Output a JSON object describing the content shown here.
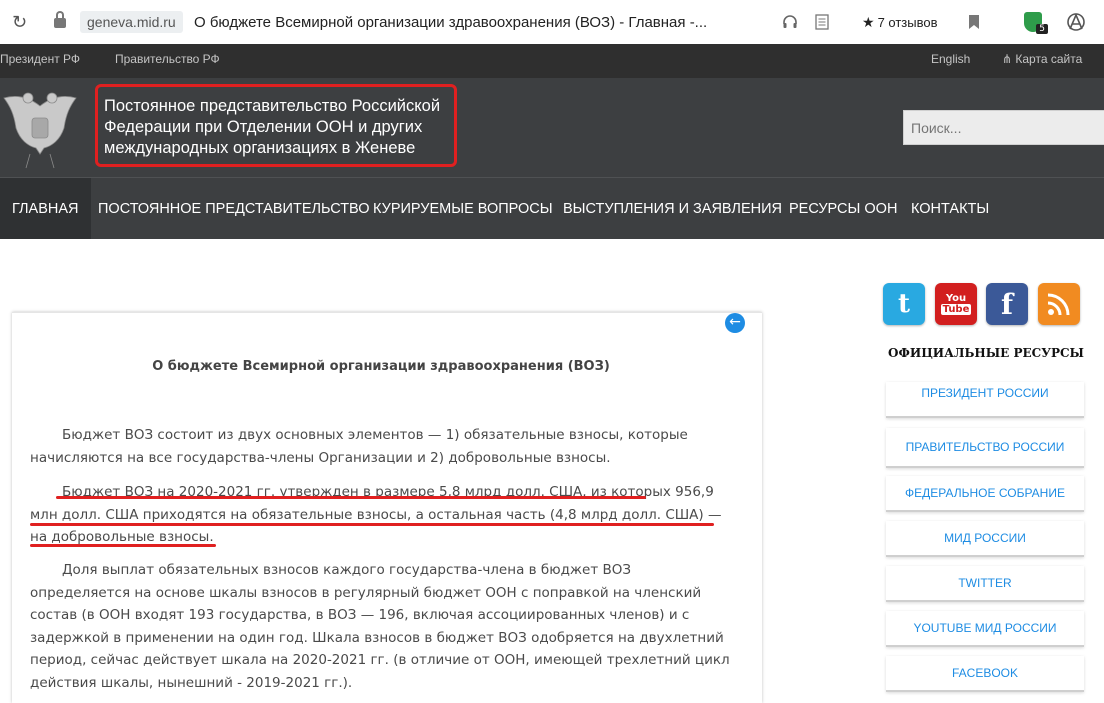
{
  "browser": {
    "domain": "geneva.mid.ru",
    "tab_title": "О бюджете Всемирной организации здравоохранения (ВОЗ) - Главная -...",
    "reviews_label": "7 отзывов",
    "shield_badge": "5"
  },
  "topbar": {
    "president_link": "Президент РФ",
    "government_link": "Правительство РФ",
    "english_link": "English",
    "sitemap_link": "Карта сайта"
  },
  "header": {
    "title_line1": "Постоянное представительство Российской",
    "title_line2": "Федерации при Отделении ООН и других",
    "title_line3": "международных организациях в Женеве",
    "search_placeholder": "Поиск..."
  },
  "nav": {
    "items": [
      {
        "label": "ГЛАВНАЯ"
      },
      {
        "label": "ПОСТОЯННОЕ ПРЕДСТАВИТЕЛЬСТВО"
      },
      {
        "label": "КУРИРУЕМЫЕ ВОПРОСЫ"
      },
      {
        "label": "ВЫСТУПЛЕНИЯ И ЗАЯВЛЕНИЯ"
      },
      {
        "label": "РЕСУРСЫ ООН"
      },
      {
        "label": "КОНТАКТЫ"
      }
    ]
  },
  "article": {
    "title": "О бюджете Всемирной организации здравоохранения (ВОЗ)",
    "paragraph1": "Бюджет ВОЗ состоит из двух основных элементов — 1) обязательные взносы, которые начисляются на все государства-члены Организации и 2) добровольные взносы.",
    "paragraph2": "Бюджет ВОЗ на 2020-2021 гг. утвержден в размере 5,8 млрд долл. США, из которых 956,9 млн долл. США приходятся на обязательные взносы, а остальная часть (4,8 млрд долл. США) — на добровольные взносы.",
    "paragraph3": "Доля выплат обязательных взносов каждого государства-члена в бюджет ВОЗ определяется на основе шкалы взносов в регулярный бюджет ООН с поправкой на членский состав (в ООН входят 193 государства, в ВОЗ — 196, включая ассоциированных членов) и с задержкой в применении на один год. Шкала взносов в бюджет ВОЗ одобряется на двухлетний период, сейчас действует шкала на 2020-2021 гг. (в отличие от ООН, имеющей трехлетний цикл действия шкалы, нынешний - 2019-2021 гг.)."
  },
  "social": {
    "youtube_top": "You",
    "youtube_bottom": "Tube"
  },
  "sidebar": {
    "resources_title": "ОФИЦИАЛЬНЫЕ РЕСУРСЫ",
    "items": [
      {
        "label": "ПРЕЗИДЕНТ РОССИИ"
      },
      {
        "label": "ПРАВИТЕЛЬСТВО РОССИИ"
      },
      {
        "label": "ФЕДЕРАЛЬНОЕ СОБРАНИЕ"
      },
      {
        "label": "МИД РОССИИ"
      },
      {
        "label": "TWITTER"
      },
      {
        "label": "YOUTUBE МИД РОССИИ"
      },
      {
        "label": "FACEBOOK"
      }
    ]
  },
  "colors": {
    "accent_link": "#1e8ce3",
    "header_bg": "#3d3f41",
    "annotation_red": "#e02020"
  }
}
